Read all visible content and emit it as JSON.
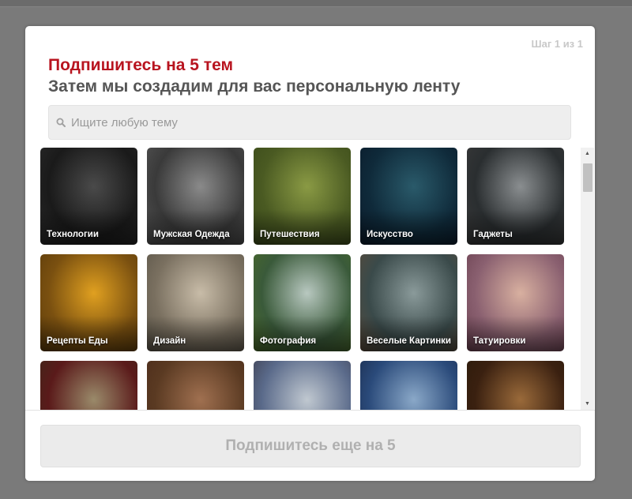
{
  "modal": {
    "step": "Шаг 1 из 1",
    "title": "Подпишитесь на 5 тем",
    "subtitle": "Затем мы создадим для вас персональную ленту"
  },
  "search": {
    "placeholder": "Ищите любую тему",
    "icon": "search-icon"
  },
  "topics": [
    {
      "label": "Технологии",
      "colors": [
        "#1a1a1a",
        "#4a4a4a",
        "#2a2a2a"
      ]
    },
    {
      "label": "Мужская Одежда",
      "colors": [
        "#3a3a3a",
        "#8a8a8a",
        "#555555"
      ]
    },
    {
      "label": "Путешествия",
      "colors": [
        "#4a5a22",
        "#8a9a44",
        "#3a4a1a"
      ]
    },
    {
      "label": "Искусство",
      "colors": [
        "#0f2a3a",
        "#2a5a6a",
        "#0a1a2a"
      ]
    },
    {
      "label": "Гаджеты",
      "colors": [
        "#2a2e30",
        "#8a8e90",
        "#3a3a3a"
      ]
    },
    {
      "label": "Рецепты Еды",
      "colors": [
        "#7a5010",
        "#e0a020",
        "#5a3a0a"
      ]
    },
    {
      "label": "Дизайн",
      "colors": [
        "#7a7060",
        "#c8bca8",
        "#5a5448"
      ]
    },
    {
      "label": "Фотография",
      "colors": [
        "#3a5a3a",
        "#b8c8c0",
        "#4a6a2a"
      ]
    },
    {
      "label": "Веселые Картинки",
      "colors": [
        "#3a4a4a",
        "#8a9a9a",
        "#5a4a3a"
      ]
    },
    {
      "label": "Татуировки",
      "colors": [
        "#8a6070",
        "#d8b0a0",
        "#6a4050"
      ]
    },
    {
      "label": "",
      "colors": [
        "#5a1a1a",
        "#9a8a6a",
        "#3a2a1a"
      ]
    },
    {
      "label": "",
      "colors": [
        "#5a3a22",
        "#a07050",
        "#4a2a1a"
      ]
    },
    {
      "label": "",
      "colors": [
        "#5a6a8a",
        "#c0c8d0",
        "#3a3a4a"
      ]
    },
    {
      "label": "",
      "colors": [
        "#2a4a7a",
        "#8aa8c8",
        "#1a2a4a"
      ]
    },
    {
      "label": "",
      "colors": [
        "#3a2010",
        "#9a6a3a",
        "#2a1a0a"
      ]
    }
  ],
  "footer": {
    "button_label": "Подпишитесь еще на 5"
  }
}
